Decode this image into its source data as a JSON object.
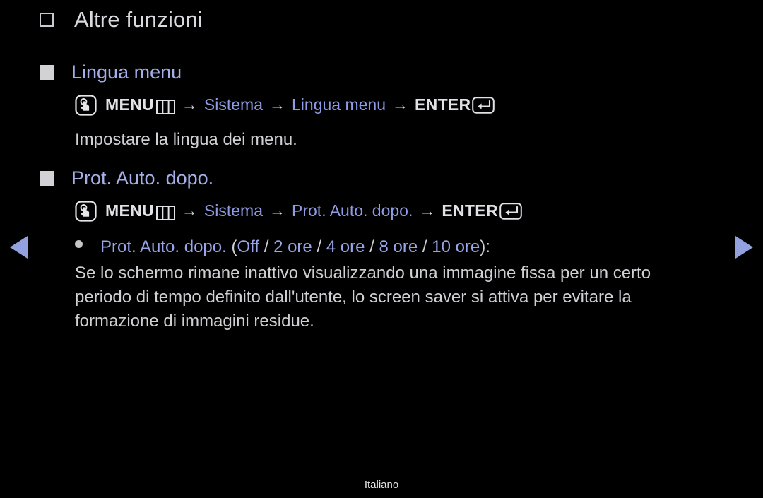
{
  "page": {
    "title": "Altre funzioni",
    "footer_language": "Italiano",
    "background_color": "#000000",
    "accent_color": "#98a5e8",
    "text_color": "#cfcfd4"
  },
  "nav": {
    "prev_icon": "triangle-left-icon",
    "next_icon": "triangle-right-icon",
    "arrow_color": "#93a1de"
  },
  "sections": [
    {
      "heading": "Lingua menu",
      "path": {
        "menu_icon": "touch-press-icon",
        "menu_label": "MENU",
        "menu_glyph": "menu-grid-icon",
        "arrow": "→",
        "step1": "Sistema",
        "step2": "Lingua menu",
        "enter_label": "ENTER",
        "enter_glyph": "enter-key-icon"
      },
      "description": "Impostare la lingua dei menu."
    },
    {
      "heading": "Prot. Auto. dopo.",
      "path": {
        "menu_icon": "touch-press-icon",
        "menu_label": "MENU",
        "menu_glyph": "menu-grid-icon",
        "arrow": "→",
        "step1": "Sistema",
        "step2": "Prot. Auto. dopo.",
        "enter_label": "ENTER",
        "enter_glyph": "enter-key-icon"
      },
      "option": {
        "bullet": "dot-icon",
        "name": "Prot. Auto. dopo.",
        "open_paren": "(",
        "values": [
          "Off",
          "2 ore",
          "4 ore",
          "8 ore",
          "10 ore"
        ],
        "separator": "/",
        "close_paren": ")",
        "colon": ":"
      },
      "description": "Se lo schermo rimane inattivo visualizzando una immagine fissa per un certo periodo di tempo definito dall'utente, lo screen saver si attiva per evitare la formazione di immagini residue."
    }
  ]
}
